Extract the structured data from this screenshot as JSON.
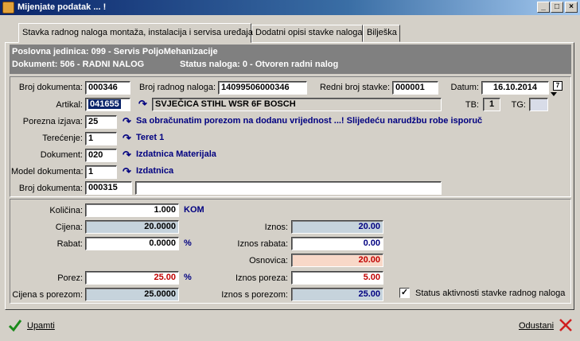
{
  "window": {
    "title": "Mijenjate podatak ... !",
    "min": "_",
    "max": "□",
    "close": "×"
  },
  "tabs": [
    {
      "label": "Stavka radnog naloga montaža, instalacija i servisa uređaja"
    },
    {
      "label": "Dodatni opisi stavke naloga"
    },
    {
      "label": "Bilješka"
    }
  ],
  "info": {
    "line1": "Poslovna jedinica: 099 - Servis PoljoMehanizacije",
    "line2": "Dokument: 506 - RADNI NALOG",
    "status": "Status naloga: 0 - Otvoren radni nalog"
  },
  "header": {
    "broj_dokumenta_label": "Broj dokumenta:",
    "broj_dokumenta": "000346",
    "broj_radnog_naloga_label": "Broj radnog naloga:",
    "broj_radnog_naloga": "14099506000346",
    "redni_broj_label": "Redni broj stavke:",
    "redni_broj": "000001",
    "datum_label": "Datum:",
    "datum": "16.10.2014",
    "artikal_label": "Artikal:",
    "artikal_code": "041655",
    "artikal_name": "SVJEČICA STIHL WSR 6F BOSCH",
    "tb_label": "TB:",
    "tb": "1",
    "tg_label": "TG:",
    "tg": "",
    "porezna_label": "Porezna izjava:",
    "porezna": "25",
    "porezna_desc": "Sa obračunatim porezom na dodanu vrijednost ...! Slijedeću narudžbu robe isporuč",
    "terecenje_label": "Terećenje:",
    "terecenje": "1",
    "terecenje_desc": "Teret 1",
    "dokument_label": "Dokument:",
    "dokument": "020",
    "dokument_desc": "Izdatnica Materijala",
    "model_label": "Model dokumenta:",
    "model": "1",
    "model_desc": "Izdatnica",
    "broj_dok2_label": "Broj dokumenta:",
    "broj_dok2": "000315",
    "broj_dok2_extra": ""
  },
  "amounts": {
    "kolicina_label": "Količina:",
    "kolicina": "1.000",
    "jm": "KOM",
    "cijena_label": "Cijena:",
    "cijena": "20.0000",
    "rabat_label": "Rabat:",
    "rabat": "0.0000",
    "rabat_pct": "%",
    "porez_label": "Porez:",
    "porez": "25.00",
    "porez_pct": "%",
    "cijena_s_porezom_label": "Cijena s porezom:",
    "cijena_s_porezom": "25.0000",
    "iznos_label": "Iznos:",
    "iznos": "20.00",
    "iznos_rabata_label": "Iznos rabata:",
    "iznos_rabata": "0.00",
    "osnovica_label": "Osnovica:",
    "osnovica": "20.00",
    "iznos_poreza_label": "Iznos poreza:",
    "iznos_poreza": "5.00",
    "iznos_s_porezom_label": "Iznos s porezom:",
    "iznos_s_porezom": "25.00",
    "status_label": "Status aktivnosti stavke radnog naloga",
    "status_checked": "✓"
  },
  "footer": {
    "save": "Upamti",
    "cancel": "Odustani"
  }
}
